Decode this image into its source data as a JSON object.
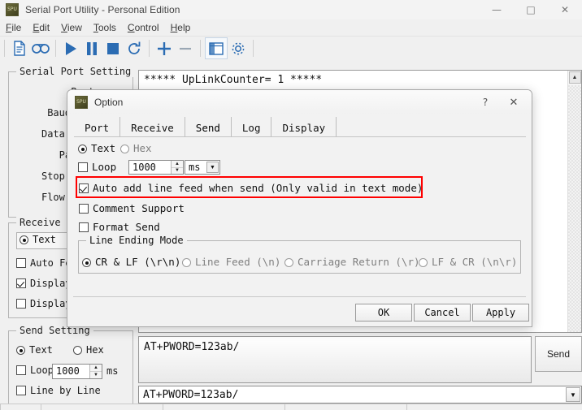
{
  "window": {
    "title": "Serial Port Utility - Personal Edition",
    "icon": "app-icon",
    "minimize": "—",
    "maximize": "□",
    "close": "✕"
  },
  "menu": {
    "items": [
      {
        "label": "File",
        "accel": "F"
      },
      {
        "label": "Edit",
        "accel": "E"
      },
      {
        "label": "View",
        "accel": "V"
      },
      {
        "label": "Tools",
        "accel": "T"
      },
      {
        "label": "Control",
        "accel": "C"
      },
      {
        "label": "Help",
        "accel": "H"
      }
    ]
  },
  "toolbar": {
    "buttons": [
      {
        "name": "new-file-icon"
      },
      {
        "name": "record-icon"
      },
      {
        "name": "play-icon"
      },
      {
        "name": "pause-icon"
      },
      {
        "name": "stop-icon"
      },
      {
        "name": "refresh-icon"
      },
      {
        "name": "plus-icon"
      },
      {
        "name": "minus-icon"
      },
      {
        "name": "layout-icon"
      },
      {
        "name": "gear-icon"
      }
    ]
  },
  "sidebar": {
    "serial_port_setting": {
      "title": "Serial Port Setting",
      "fields": [
        "Port",
        "Baudrate",
        "Data Bits",
        "Parity",
        "Stop Bits",
        "Flow Type"
      ]
    },
    "receive_setting": {
      "title": "Receive S",
      "mode_text": "Text",
      "mode_text_checked": true,
      "options": [
        {
          "label": "Auto Fe",
          "checked": false
        },
        {
          "label": "Display",
          "checked": true
        },
        {
          "label": "Display",
          "checked": false
        }
      ]
    },
    "send_setting": {
      "title": "Send Setting",
      "mode_text": "Text",
      "mode_hex": "Hex",
      "mode_text_checked": true,
      "loop_label": "Loop",
      "loop_checked": false,
      "loop_value": "1000",
      "loop_unit": "ms",
      "line_by_line_label": "Line by Line",
      "line_by_line_checked": false
    }
  },
  "receive_area": {
    "text": "***** UpLinkCounter= 1 *****",
    "scroll_up": "▲"
  },
  "send_area": {
    "editor_value": "AT+PWORD=123ab/",
    "combo_value": "AT+PWORD=123ab/",
    "send_button": "Send",
    "combo_arrow": "▼"
  },
  "dialog": {
    "title": "Option",
    "icon": "app-icon",
    "help_glyph": "?",
    "close_glyph": "✕",
    "tabs": [
      {
        "label": "Port",
        "active": false
      },
      {
        "label": "Receive",
        "active": false
      },
      {
        "label": "Send",
        "active": true
      },
      {
        "label": "Log",
        "active": false
      },
      {
        "label": "Display",
        "active": false
      }
    ],
    "send_tab": {
      "mode_text": "Text",
      "mode_hex": "Hex",
      "mode_text_checked": true,
      "mode_hex_checked": false,
      "loop_label": "Loop",
      "loop_checked": false,
      "loop_value": "1000",
      "loop_unit": "ms",
      "loop_unit_arrow": "▼",
      "spin_up": "▲",
      "spin_down": "▼",
      "auto_linefeed_label": "Auto add line feed when send (Only valid in text mode)",
      "auto_linefeed_checked": true,
      "comment_support_label": "Comment Support",
      "comment_support_checked": false,
      "format_send_label": "Format Send",
      "format_send_checked": false,
      "line_ending": {
        "title": "Line Ending Mode",
        "options": [
          {
            "label": "CR & LF (\\r\\n)",
            "checked": true
          },
          {
            "label": "Line Feed (\\n)",
            "checked": false
          },
          {
            "label": "Carriage Return (\\r)",
            "checked": false
          },
          {
            "label": "LF & CR (\\n\\r)",
            "checked": false
          }
        ]
      }
    },
    "buttons": {
      "ok": "OK",
      "cancel": "Cancel",
      "apply": "Apply"
    }
  },
  "colors": {
    "accent_blue": "#2b6cb3",
    "highlight_red": "#ff0000",
    "window_bg": "#f0f0f0",
    "dialog_bg": "#f2f2f2"
  }
}
